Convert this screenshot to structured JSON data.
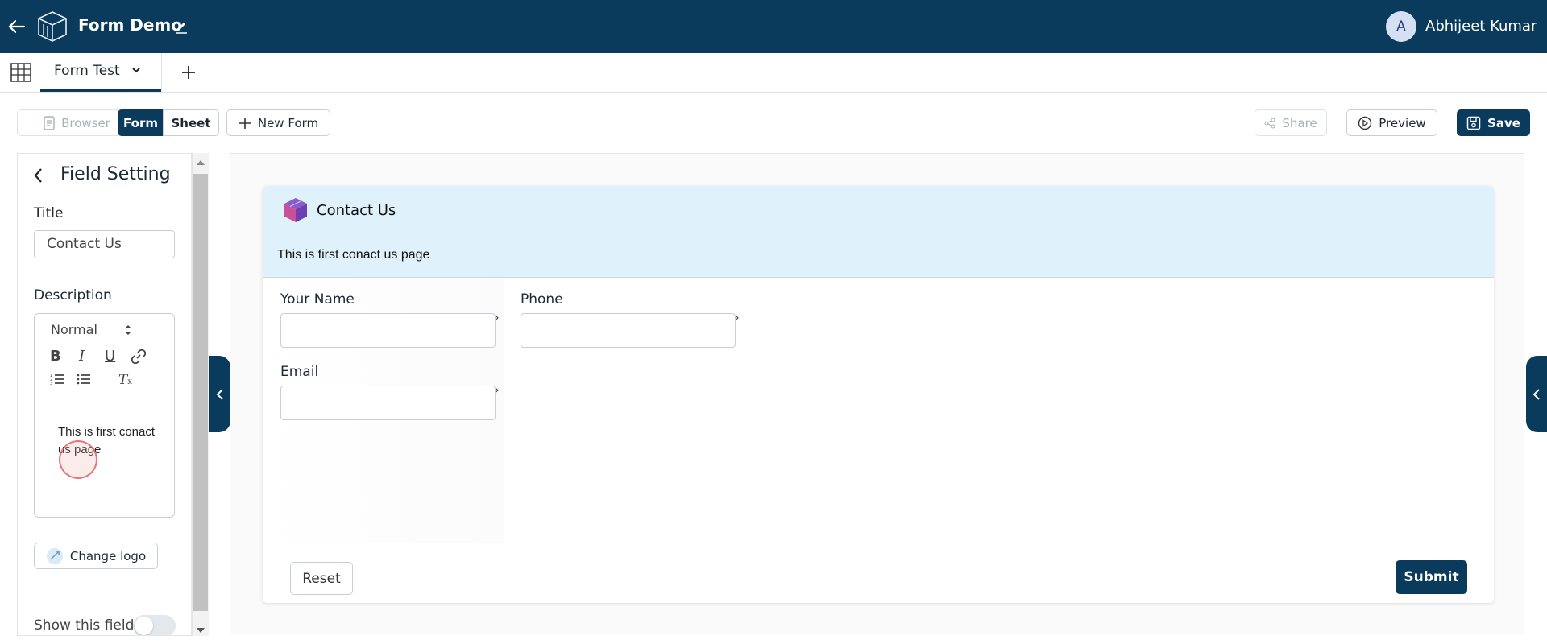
{
  "app": {
    "title": "Form Demo",
    "user": {
      "initial": "A",
      "name": "Abhijeet Kumar"
    }
  },
  "tabs": [
    {
      "label": "Form Test"
    }
  ],
  "toolbar": {
    "browser": "Browser",
    "form": "Form",
    "sheet": "Sheet",
    "new_form": "New Form",
    "share": "Share",
    "preview": "Preview",
    "save": "Save"
  },
  "field_setting": {
    "heading": "Field Setting",
    "title_label": "Title",
    "title_value": "Contact Us",
    "description_label": "Description",
    "format_select": "Normal",
    "description_text": "This is first conact us page",
    "change_logo": "Change logo",
    "show_field": "Show this field"
  },
  "form": {
    "title": "Contact Us",
    "description": "This is first conact us page",
    "fields": {
      "name": "Your Name",
      "phone": "Phone",
      "email": "Email"
    },
    "reset": "Reset",
    "submit": "Submit"
  },
  "colors": {
    "brand": "#0b3b5c",
    "header_bg": "#dff2fb"
  }
}
